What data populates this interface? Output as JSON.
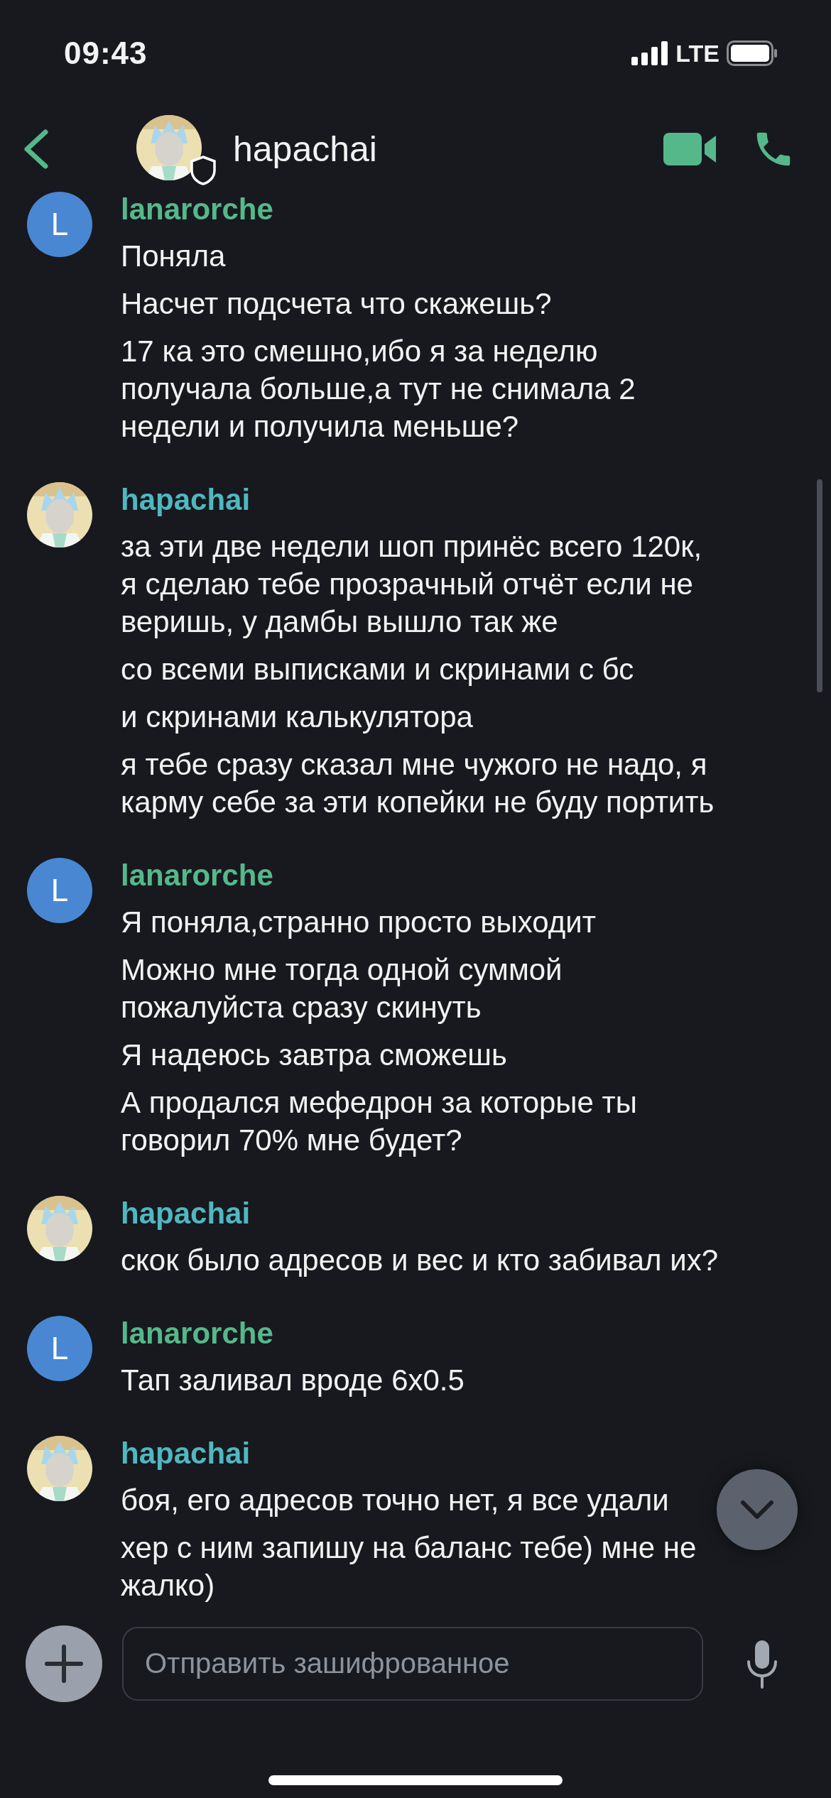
{
  "status_bar": {
    "time": "09:43",
    "network": "LTE"
  },
  "header": {
    "title": "hapachai"
  },
  "messages": [
    {
      "author": "lanarorche",
      "color": "#55b88b",
      "avatar": {
        "kind": "letter",
        "letter": "L"
      },
      "lines": [
        "Поняла",
        "Насчет подсчета что скажешь?",
        "17 ка это смешно,ибо я за неделю\nполучала больше,а тут не снимала 2\nнедели и получила меньше?"
      ]
    },
    {
      "author": "hapachai",
      "color": "#4fb8c0",
      "avatar": {
        "kind": "picture"
      },
      "lines": [
        "за эти две недели шоп принёс всего 120к,\nя сделаю тебе прозрачный отчёт если не\nверишь, у дамбы вышло так же",
        "со всеми выписками и скринами с бс",
        "и скринами калькулятора",
        "я тебе сразу сказал мне чужого не надо, я\nкарму себе за эти копейки не буду портить"
      ]
    },
    {
      "author": "lanarorche",
      "color": "#55b88b",
      "avatar": {
        "kind": "letter",
        "letter": "L"
      },
      "lines": [
        "Я поняла,странно просто выходит",
        "Можно мне тогда одной суммой\nпожалуйста сразу скинуть",
        "Я надеюсь завтра сможешь",
        "А продался мефедрон за которые ты\nговорил 70% мне будет?"
      ]
    },
    {
      "author": "hapachai",
      "color": "#4fb8c0",
      "avatar": {
        "kind": "picture"
      },
      "lines": [
        "скок было адресов и вес и кто забивал их?"
      ]
    },
    {
      "author": "lanarorche",
      "color": "#55b88b",
      "avatar": {
        "kind": "letter",
        "letter": "L"
      },
      "lines": [
        "Тап заливал вроде 6х0.5"
      ]
    },
    {
      "author": "hapachai",
      "color": "#4fb8c0",
      "avatar": {
        "kind": "picture"
      },
      "lines": [
        "боя, его адресов точно нет, я все удали",
        "хер с ним запишу на баланс тебе) мне не\nжалко)"
      ]
    }
  ],
  "composer": {
    "placeholder": "Отправить зашифрованное"
  }
}
